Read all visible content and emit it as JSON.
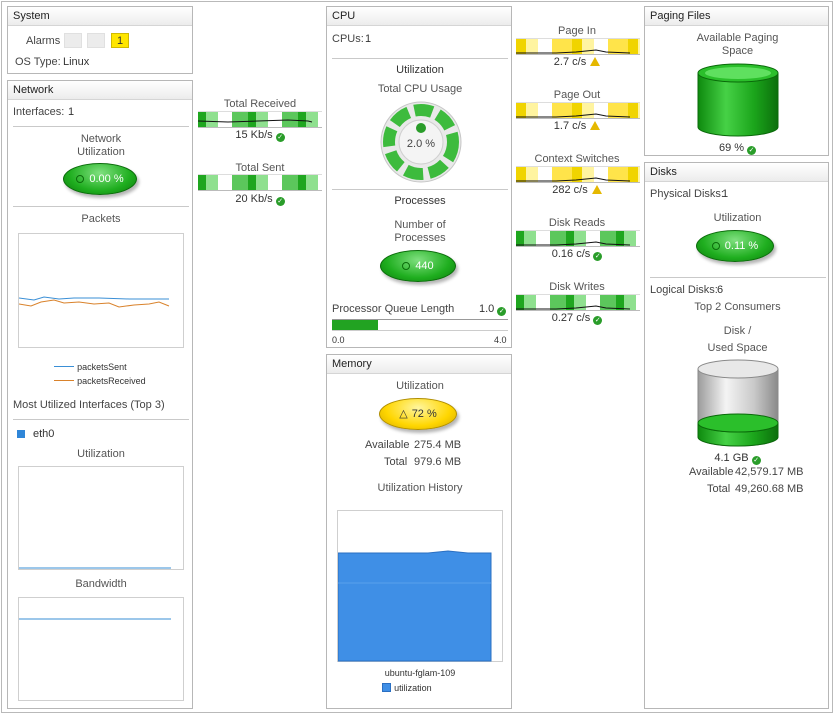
{
  "system": {
    "title": "System",
    "alarms_label": "Alarms",
    "alarm_count": "1",
    "os_type_label": "OS Type:",
    "os_type_value": "Linux"
  },
  "network": {
    "title": "Network",
    "interfaces_label": "Interfaces:",
    "interfaces_value": "1",
    "utilization_label_line1": "Network",
    "utilization_label_line2": "Utilization",
    "utilization_value": "0.00 %",
    "packets_title": "Packets",
    "legend_sent": "packetsSent",
    "legend_received": "packetsReceived",
    "sent_color": "#3a8fd6",
    "received_color": "#d9822b",
    "most_utilized_title": "Most Utilized Interfaces (Top 3)",
    "interface_name": "eth0",
    "interface_utilization_title": "Utilization",
    "interface_bandwidth_title": "Bandwidth"
  },
  "traffic": {
    "received_label": "Total Received",
    "received_value": "15 Kb/s",
    "sent_label": "Total Sent",
    "sent_value": "20 Kb/s"
  },
  "cpu": {
    "title": "CPU",
    "cpus_label": "CPUs:",
    "cpus_value": "1",
    "utilization_section": "Utilization",
    "total_usage_label": "Total CPU Usage",
    "total_usage_value": "2.0 %",
    "processes_section": "Processes",
    "num_processes_line1": "Number of",
    "num_processes_line2": "Processes",
    "num_processes_value": "440",
    "queue_label": "Processor Queue Length",
    "queue_value": "1.0",
    "queue_fraction": 0.25,
    "queue_min": "0.0",
    "queue_max": "4.0"
  },
  "memory": {
    "title": "Memory",
    "utilization_label": "Utilization",
    "utilization_value": "72 %",
    "available_label": "Available",
    "available_value": "275.4 MB",
    "total_label": "Total",
    "total_value": "979.6 MB",
    "history_title": "Utilization History",
    "host_label": "ubuntu-fglam-109",
    "legend_label": "utilization",
    "area_color": "#3f8fe6"
  },
  "rates": [
    {
      "label": "Page In",
      "value": "2.7 c/s",
      "status": "warning",
      "style": "yellow"
    },
    {
      "label": "Page Out",
      "value": "1.7 c/s",
      "status": "warning",
      "style": "yellow"
    },
    {
      "label": "Context Switches",
      "value": "282 c/s",
      "status": "warning",
      "style": "yellow"
    },
    {
      "label": "Disk Reads",
      "value": "0.16 c/s",
      "status": "ok",
      "style": "green"
    },
    {
      "label": "Disk Writes",
      "value": "0.27 c/s",
      "status": "ok",
      "style": "green"
    }
  ],
  "paging": {
    "title": "Paging Files",
    "available_line1": "Available Paging",
    "available_line2": "Space",
    "value": "69 %",
    "fill_fraction": 0.69
  },
  "disks": {
    "title": "Disks",
    "physical_label": "Physical Disks:",
    "physical_value": "1",
    "utilization_label": "Utilization",
    "utilization_value": "0.11 %",
    "logical_label": "Logical Disks:",
    "logical_value": "6",
    "top_consumers": "Top 2 Consumers",
    "disk_label_line1": "Disk /",
    "disk_label_line2": "Used Space",
    "used_value": "4.1 GB",
    "available_label": "Available",
    "available_value": "42,579.17 MB",
    "total_label": "Total",
    "total_value": "49,260.68 MB",
    "used_fraction": 0.08
  }
}
